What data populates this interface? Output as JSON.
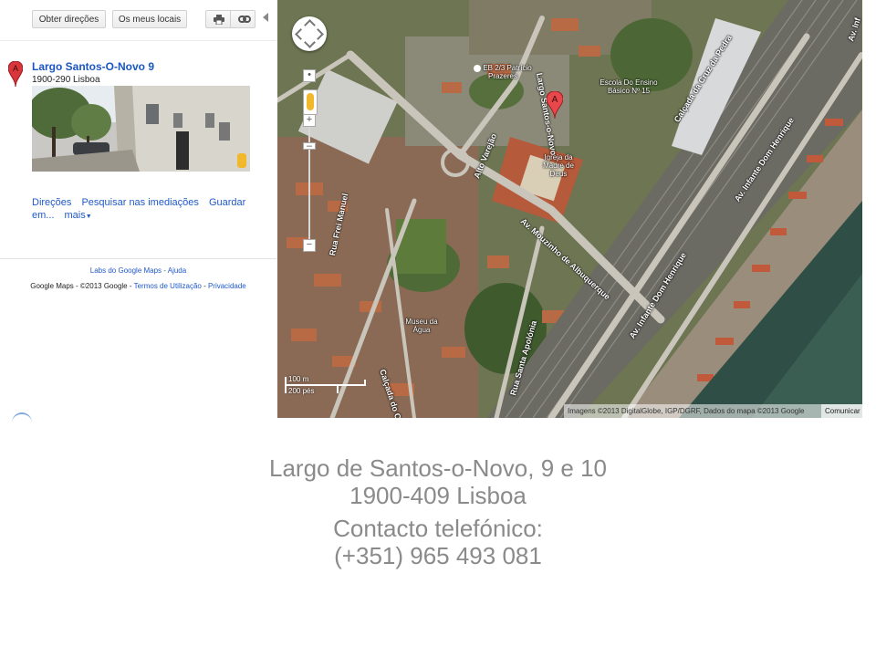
{
  "toolbar": {
    "directions_button": "Obter direções",
    "my_places_button": "Os meus locais",
    "print_icon": "print-icon",
    "link_icon": "link-icon"
  },
  "place": {
    "marker_letter": "A",
    "name": "Largo Santos-O-Novo 9",
    "address": "1900-290 Lisboa"
  },
  "actions": {
    "directions": "Direções",
    "search_nearby": "Pesquisar nas imediações",
    "save": "Guardar em...",
    "more": "mais"
  },
  "footer": {
    "labs": "Labs do Google Maps",
    "sep": " - ",
    "help": "Ajuda",
    "copyright": "Google Maps - ©2013 Google",
    "terms": "Termos de Utilização",
    "privacy": "Privacidade"
  },
  "map": {
    "marker_letter": "A",
    "scale_small": "100 m",
    "scale_large": "200 pés",
    "credits": "Imagens ©2013 DigitalGlobe, IGP/DGRF, Dados do mapa ©2013 Google",
    "report_link": "Comunicar",
    "streets": [
      "Alto Varejão",
      "Calçada da Cruz da Pedra",
      "Av. Mouzinho de Albuquerque",
      "Av. Infante Dom Henrique",
      "Av. Infante Dom Henrique",
      "Rua Santa Apolónia",
      "Calçada do Cascão",
      "Rua Frei Manuel",
      "Largo Santos-o-Novo",
      "Av. Inf"
    ],
    "pois": [
      "EB 2/3 Patrício Prazeres",
      "Escola Do Ensino Básico Nº 15",
      "Igreja da Madre de Deus",
      "Museu da Água"
    ]
  },
  "contact": {
    "line1": "Largo de Santos-o-Novo, 9 e 10",
    "line2": "1900-409 Lisboa",
    "line3": "Contacto telefónico:",
    "line4": "(+351) 965 493 081"
  },
  "colors": {
    "link": "#2059c8",
    "marker": "#d9363b",
    "contact_text": "#8a8a8a"
  }
}
